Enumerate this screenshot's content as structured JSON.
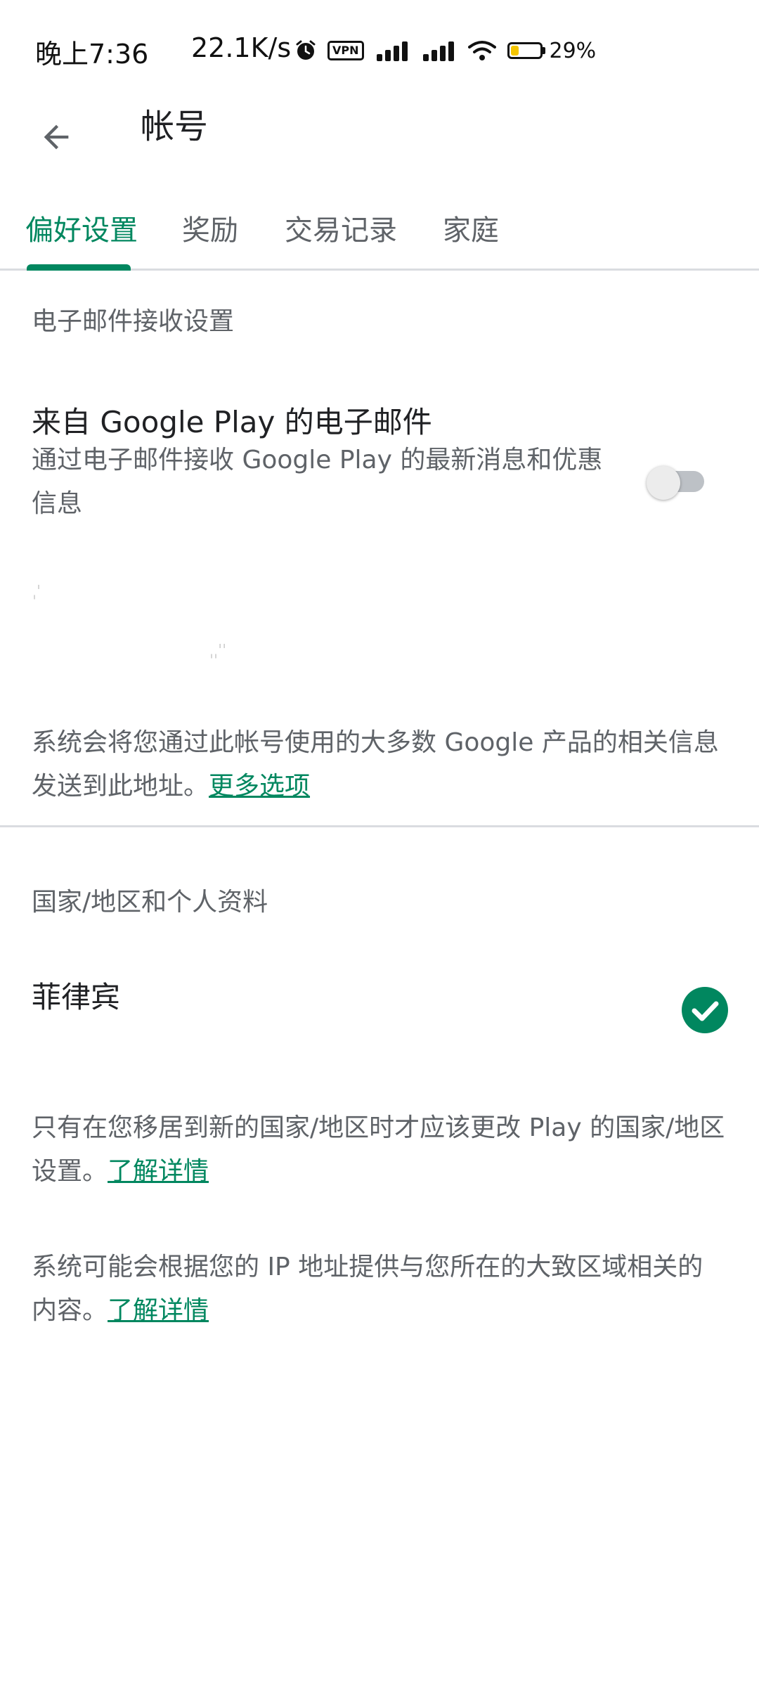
{
  "status_bar": {
    "time": "晚上7:36",
    "network_speed": "22.1K/s",
    "vpn_label": "VPN",
    "battery_percent": "29%",
    "battery_level": 0.29,
    "icons": [
      "alarm-icon",
      "vpn-icon",
      "signal-icon",
      "signal-icon",
      "wifi-icon",
      "battery-icon"
    ]
  },
  "app_bar": {
    "title": "帐号",
    "back_icon": "arrow-back-icon"
  },
  "tabs": [
    {
      "label": "偏好设置",
      "active": true
    },
    {
      "label": "奖励",
      "active": false
    },
    {
      "label": "交易记录",
      "active": false
    },
    {
      "label": "家庭",
      "active": false
    }
  ],
  "email_section": {
    "header": "电子邮件接收设置",
    "title": "来自 Google Play 的电子邮件",
    "description": "通过电子邮件接收 Google Play 的最新消息和优惠信息",
    "toggle_on": false,
    "info_text": "系统会将您通过此帐号使用的大多数 Google 产品的相关信息发送到此地址。",
    "more_options_link": "更多选项"
  },
  "country_section": {
    "header": "国家/地区和个人资料",
    "country": "菲律宾",
    "selected": true,
    "change_info": "只有在您移居到新的国家/地区时才应该更改 Play 的国家/地区设置。",
    "learn_more_1": "了解详情",
    "ip_info": "系统可能会根据您的 IP 地址提供与您所在的大致区域相关的内容。",
    "learn_more_2": "了解详情"
  },
  "colors": {
    "accent": "#01875f",
    "divider": "#dadce0",
    "text_primary": "#202124",
    "text_secondary": "#5f6368"
  }
}
